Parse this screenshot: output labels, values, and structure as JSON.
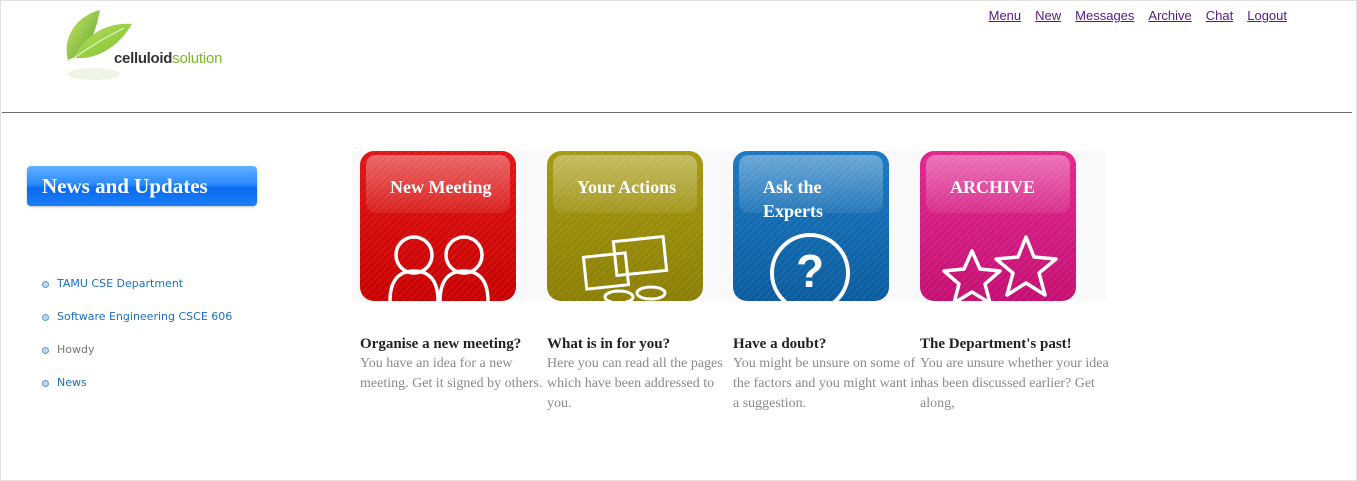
{
  "logo": {
    "word1": "celluloid",
    "word2": "solution",
    "leaf_color": "#8cc63f"
  },
  "topnav": [
    "Menu",
    "New",
    "Messages",
    "Archive",
    "Chat",
    "Logout"
  ],
  "sidebar": {
    "header": "News and Updates",
    "items": [
      {
        "label": "TAMU CSE Department",
        "link": true
      },
      {
        "label": "Software Engineering CSCE 606",
        "link": true
      },
      {
        "label": "Howdy",
        "link": false
      },
      {
        "label": "News",
        "link": true
      }
    ]
  },
  "tiles": [
    {
      "title": "New Meeting",
      "icon": "people-icon",
      "color": "#d40a0a",
      "heading": "Organise a new meeting?",
      "text": "You have an idea for a new meeting. Get it signed by others."
    },
    {
      "title": "Your Actions",
      "icon": "monitors-icon",
      "color": "#9a8d0a",
      "heading": "What is in for you?",
      "text": "Here you can read all the pages which have been addressed to you."
    },
    {
      "title": "Ask the Experts",
      "icon": "question-icon",
      "color": "#1269b0",
      "heading": "Have a doubt?",
      "text": "You might be unsure on some of the factors and you might want in a suggestion."
    },
    {
      "title": "ARCHIVE",
      "icon": "stars-icon",
      "color": "#d41a80",
      "heading": "The Department's past!",
      "text": "You are unsure whether your idea has been discussed earlier? Get along,"
    }
  ]
}
